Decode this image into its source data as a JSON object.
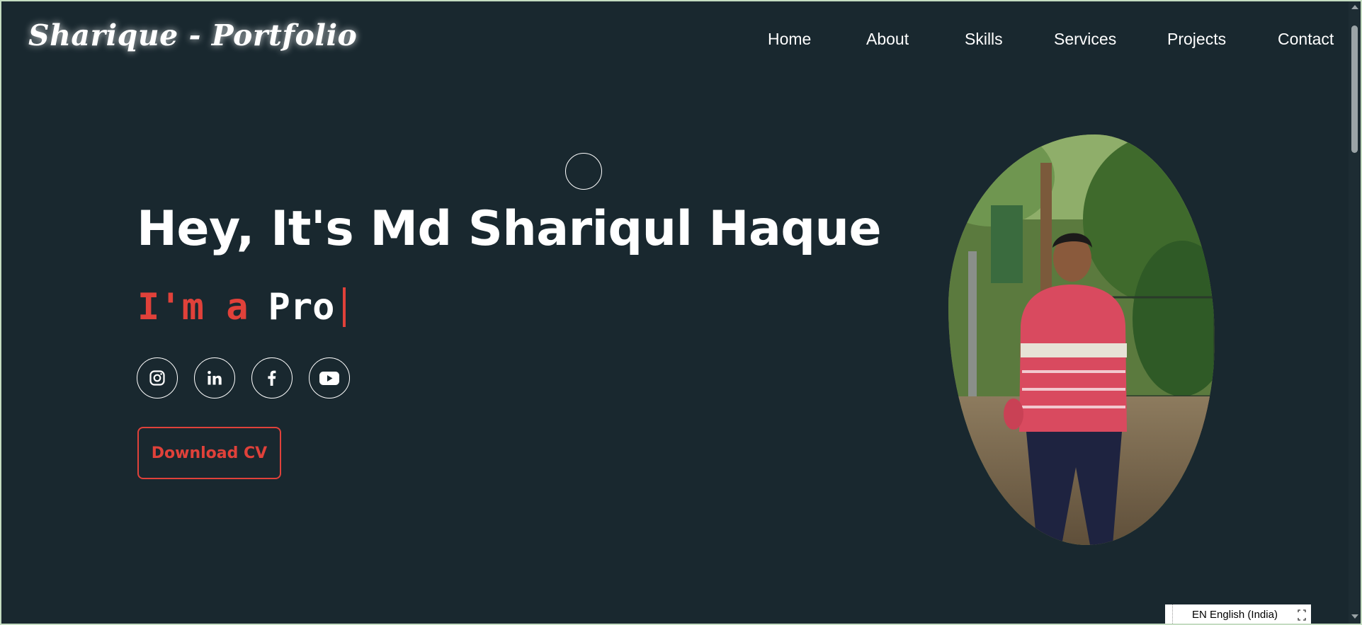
{
  "brand": {
    "logo": "Sharique - Portfolio"
  },
  "nav": {
    "items": [
      "Home",
      "About",
      "Skills",
      "Services",
      "Projects",
      "Contact"
    ]
  },
  "hero": {
    "title": "Hey, It's Md Shariqul Haque",
    "typed_prefix": "I'm a",
    "typed_word": "Pro",
    "cta_label": "Download CV"
  },
  "social": [
    "instagram-icon",
    "linkedin-icon",
    "facebook-icon",
    "youtube-icon"
  ],
  "language_bar": {
    "label": "EN English (India)"
  },
  "colors": {
    "background": "#19282f",
    "accent": "#e0413a",
    "text": "#ffffff"
  }
}
